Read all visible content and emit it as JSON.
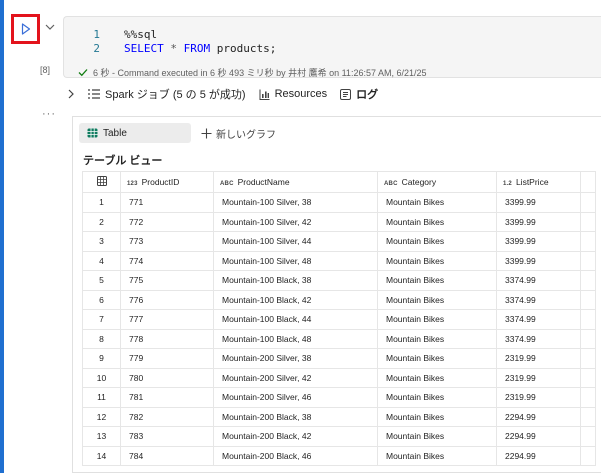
{
  "cell": {
    "execution_count": "[8]",
    "code_lines": [
      {
        "num": "1",
        "text": "%%sql"
      },
      {
        "num": "2",
        "parts": [
          "SELECT",
          "*",
          "FROM",
          "products;"
        ]
      }
    ],
    "status_text": "6 秒 - Command executed in 6 秒 493 ミリ秒 by 井村 鷹希 on 11:26:57 AM, 6/21/25"
  },
  "jobs_bar": {
    "spark_jobs": "Spark ジョブ (5 の 5 が成功)",
    "resources": "Resources",
    "log": "ログ"
  },
  "output": {
    "tab_table": "Table",
    "new_graph": "新しいグラフ",
    "view_title": "テーブル ビュー",
    "columns": [
      {
        "type": "123",
        "name": "ProductID"
      },
      {
        "type": "ABC",
        "name": "ProductName"
      },
      {
        "type": "ABC",
        "name": "Category"
      },
      {
        "type": "1.2",
        "name": "ListPrice"
      }
    ],
    "rows": [
      [
        "1",
        "771",
        "Mountain-100 Silver, 38",
        "Mountain Bikes",
        "3399.99"
      ],
      [
        "2",
        "772",
        "Mountain-100 Silver, 42",
        "Mountain Bikes",
        "3399.99"
      ],
      [
        "3",
        "773",
        "Mountain-100 Silver, 44",
        "Mountain Bikes",
        "3399.99"
      ],
      [
        "4",
        "774",
        "Mountain-100 Silver, 48",
        "Mountain Bikes",
        "3399.99"
      ],
      [
        "5",
        "775",
        "Mountain-100 Black, 38",
        "Mountain Bikes",
        "3374.99"
      ],
      [
        "6",
        "776",
        "Mountain-100 Black, 42",
        "Mountain Bikes",
        "3374.99"
      ],
      [
        "7",
        "777",
        "Mountain-100 Black, 44",
        "Mountain Bikes",
        "3374.99"
      ],
      [
        "8",
        "778",
        "Mountain-100 Black, 48",
        "Mountain Bikes",
        "3374.99"
      ],
      [
        "9",
        "779",
        "Mountain-200 Silver, 38",
        "Mountain Bikes",
        "2319.99"
      ],
      [
        "10",
        "780",
        "Mountain-200 Silver, 42",
        "Mountain Bikes",
        "2319.99"
      ],
      [
        "11",
        "781",
        "Mountain-200 Silver, 46",
        "Mountain Bikes",
        "2319.99"
      ],
      [
        "12",
        "782",
        "Mountain-200 Black, 38",
        "Mountain Bikes",
        "2294.99"
      ],
      [
        "13",
        "783",
        "Mountain-200 Black, 42",
        "Mountain Bikes",
        "2294.99"
      ],
      [
        "14",
        "784",
        "Mountain-200 Black, 46",
        "Mountain Bikes",
        "2294.99"
      ]
    ]
  },
  "colors": {
    "accent_bar": "#1f6fd0",
    "run_highlight": "#e3131c",
    "success": "#107c10",
    "table_icon": "#0f7b5f"
  },
  "icons": [
    "run-icon",
    "chevron-down-icon",
    "checkmark-icon",
    "chevron-right-icon",
    "spark-jobs-icon",
    "resources-icon",
    "log-icon",
    "table-icon",
    "plus-icon",
    "grid-icon"
  ]
}
